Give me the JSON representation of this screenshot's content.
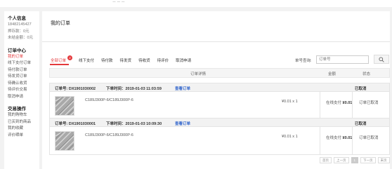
{
  "top": {
    "text": "ー  ー  ー"
  },
  "sidebar": {
    "personal_title": "个人信息",
    "phone": "18482145427",
    "deposit": "押存款：0元",
    "unsettled": "未结金额：0元",
    "order_center_title": "订单中心",
    "order_items": [
      {
        "label": "我的订单",
        "active": true
      },
      {
        "label": "线下支付订单"
      },
      {
        "label": "待付款订单"
      },
      {
        "label": "待发货订单"
      },
      {
        "label": "待确认收货"
      },
      {
        "label": "待评价交易"
      },
      {
        "label": "取消申请"
      }
    ],
    "trade_title": "交易操作",
    "trade_items": [
      {
        "label": "我的购物车"
      },
      {
        "label": "已买到的商品"
      },
      {
        "label": "我的收藏"
      },
      {
        "label": "评价晒单"
      }
    ]
  },
  "main": {
    "title": "我的订单",
    "tabs": [
      {
        "label": "全部订单",
        "badge": "2",
        "active": true
      },
      {
        "label": "线下支付"
      },
      {
        "label": "待付款"
      },
      {
        "label": "待发货"
      },
      {
        "label": "待收货"
      },
      {
        "label": "待评价"
      },
      {
        "label": "取消申请"
      }
    ],
    "search": {
      "label": "单号查询:",
      "placeholder": "订单号"
    },
    "table_headers": {
      "detail": "订单详情",
      "amount": "金额",
      "status": "状态"
    },
    "orders": [
      {
        "order_no": "订单号:  DX1901030002",
        "time": "下单时间：2019-01-03 11:03:59",
        "view": "查看订单",
        "status_head": "已取消",
        "product": "C189J300P-6/C189J300P-6",
        "price": "¥0.01 x 1",
        "pay_label": "在线支付",
        "pay_amount": "¥0.01",
        "status_detail": "订单已取消"
      },
      {
        "order_no": "订单号:  DX1901030001",
        "time": "下单时间：2019-01-03 10:09:30",
        "view": "查看订单",
        "status_head": "已取消",
        "product": "C189J300P-6/C189J300P-6",
        "price": "¥0.01 x 1",
        "pay_label": "在线支付",
        "pay_amount": "¥0.01",
        "status_detail": "订单已取消"
      }
    ],
    "pager": {
      "first": "首页",
      "prev": "上一页",
      "current": "1",
      "next": "下一页",
      "last": "末页"
    }
  }
}
